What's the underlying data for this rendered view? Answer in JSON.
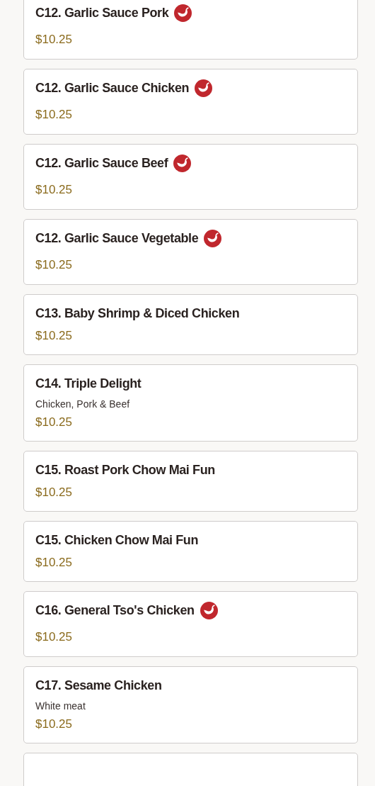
{
  "menu_items": [
    {
      "name": "C12. Garlic Sauce Pork",
      "spicy": true,
      "price": "$10.25"
    },
    {
      "name": "C12. Garlic Sauce Chicken",
      "spicy": true,
      "price": "$10.25"
    },
    {
      "name": "C12. Garlic Sauce Beef",
      "spicy": true,
      "price": "$10.25"
    },
    {
      "name": "C12. Garlic Sauce Vegetable",
      "spicy": true,
      "price": "$10.25"
    },
    {
      "name": "C13. Baby Shrimp & Diced Chicken",
      "spicy": false,
      "price": "$10.25"
    },
    {
      "name": "C14. Triple Delight",
      "spicy": false,
      "description": "Chicken, Pork & Beef",
      "price": "$10.25"
    },
    {
      "name": "C15. Roast Pork Chow Mai Fun",
      "spicy": false,
      "price": "$10.25"
    },
    {
      "name": "C15. Chicken Chow Mai Fun",
      "spicy": false,
      "price": "$10.25"
    },
    {
      "name": "C16. General Tso's Chicken",
      "spicy": true,
      "price": "$10.25"
    },
    {
      "name": "C17. Sesame Chicken",
      "spicy": false,
      "description": "White meat",
      "price": "$10.25"
    }
  ]
}
